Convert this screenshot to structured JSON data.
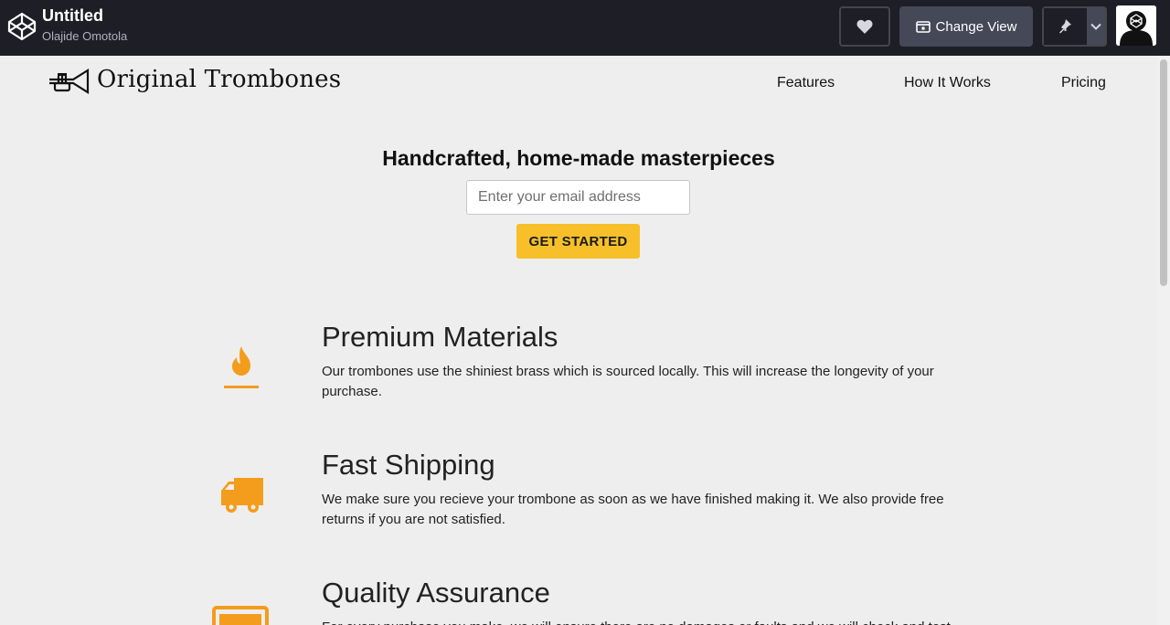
{
  "editor": {
    "pen_title": "Untitled",
    "author": "Olajide Omotola",
    "change_view_label": "Change View"
  },
  "page": {
    "brand_name": "Original Trombones",
    "nav": {
      "features": "Features",
      "how_it_works": "How It Works",
      "pricing": "Pricing"
    },
    "hero": {
      "title": "Handcrafted, home-made masterpieces",
      "email_placeholder": "Enter your email address",
      "cta_label": "GET STARTED"
    },
    "features": [
      {
        "icon": "fire-icon",
        "title": "Premium Materials",
        "desc": "Our trombones use the shiniest brass which is sourced locally. This will increase the longevity of your purchase."
      },
      {
        "icon": "truck-icon",
        "title": "Fast Shipping",
        "desc": "We make sure you recieve your trombone as soon as we have finished making it. We also provide free returns if you are not satisfied."
      },
      {
        "icon": "battery-icon",
        "title": "Quality Assurance",
        "desc": "For every purchase you make, we will ensure there are no damages or faults and we will check and test"
      }
    ]
  },
  "colors": {
    "accent": "#f7c02a",
    "icon_orange": "#f49c1c",
    "topbar": "#1e1f26"
  }
}
